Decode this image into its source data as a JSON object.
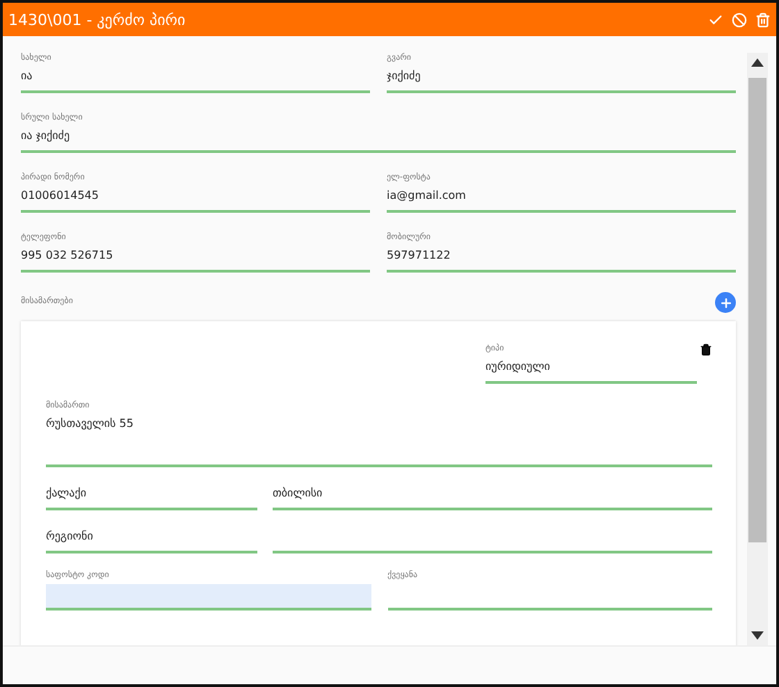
{
  "window": {
    "title": "1430\\001 - კერძო პირი"
  },
  "header_actions": [
    {
      "kind": "check"
    },
    {
      "kind": "ban"
    },
    {
      "kind": "trash"
    }
  ],
  "field_rows": [
    [
      {
        "label": "სახელი",
        "value": "ია"
      },
      {
        "label": "გვარი",
        "value": "ჯიქიძე"
      }
    ],
    [
      {
        "label": "სრული სახელი",
        "value": "ია ჯიქიძე"
      }
    ],
    [
      {
        "label": "პირადი ნომერი",
        "value": "01006014545"
      },
      {
        "label": "ელ-ფოსტა",
        "value": "ia@gmail.com"
      }
    ],
    [
      {
        "label": "ტელეფონი",
        "value": "995 032 526715"
      },
      {
        "label": "მობილური",
        "value": "597971122"
      }
    ]
  ],
  "addresses": {
    "label": "მისამართები",
    "cards": [
      {
        "type_field": {
          "label": "ტიპი",
          "value": "იურიდიული"
        },
        "address_field": {
          "label": "მისამართი",
          "value": "რუსთაველის 55",
          "kind": "multiline"
        },
        "rows": [
          [
            {
              "value": "ქალაქი"
            },
            {
              "value": "თბილისი"
            }
          ],
          [
            {
              "value": "რეგიონი"
            },
            {}
          ]
        ]
      }
    ]
  },
  "bottom_fields": [
    {
      "label": "საფოსტო კოდი",
      "highlighted": true
    },
    {
      "label": "ქვეყანა",
      "highlighted": false
    }
  ]
}
